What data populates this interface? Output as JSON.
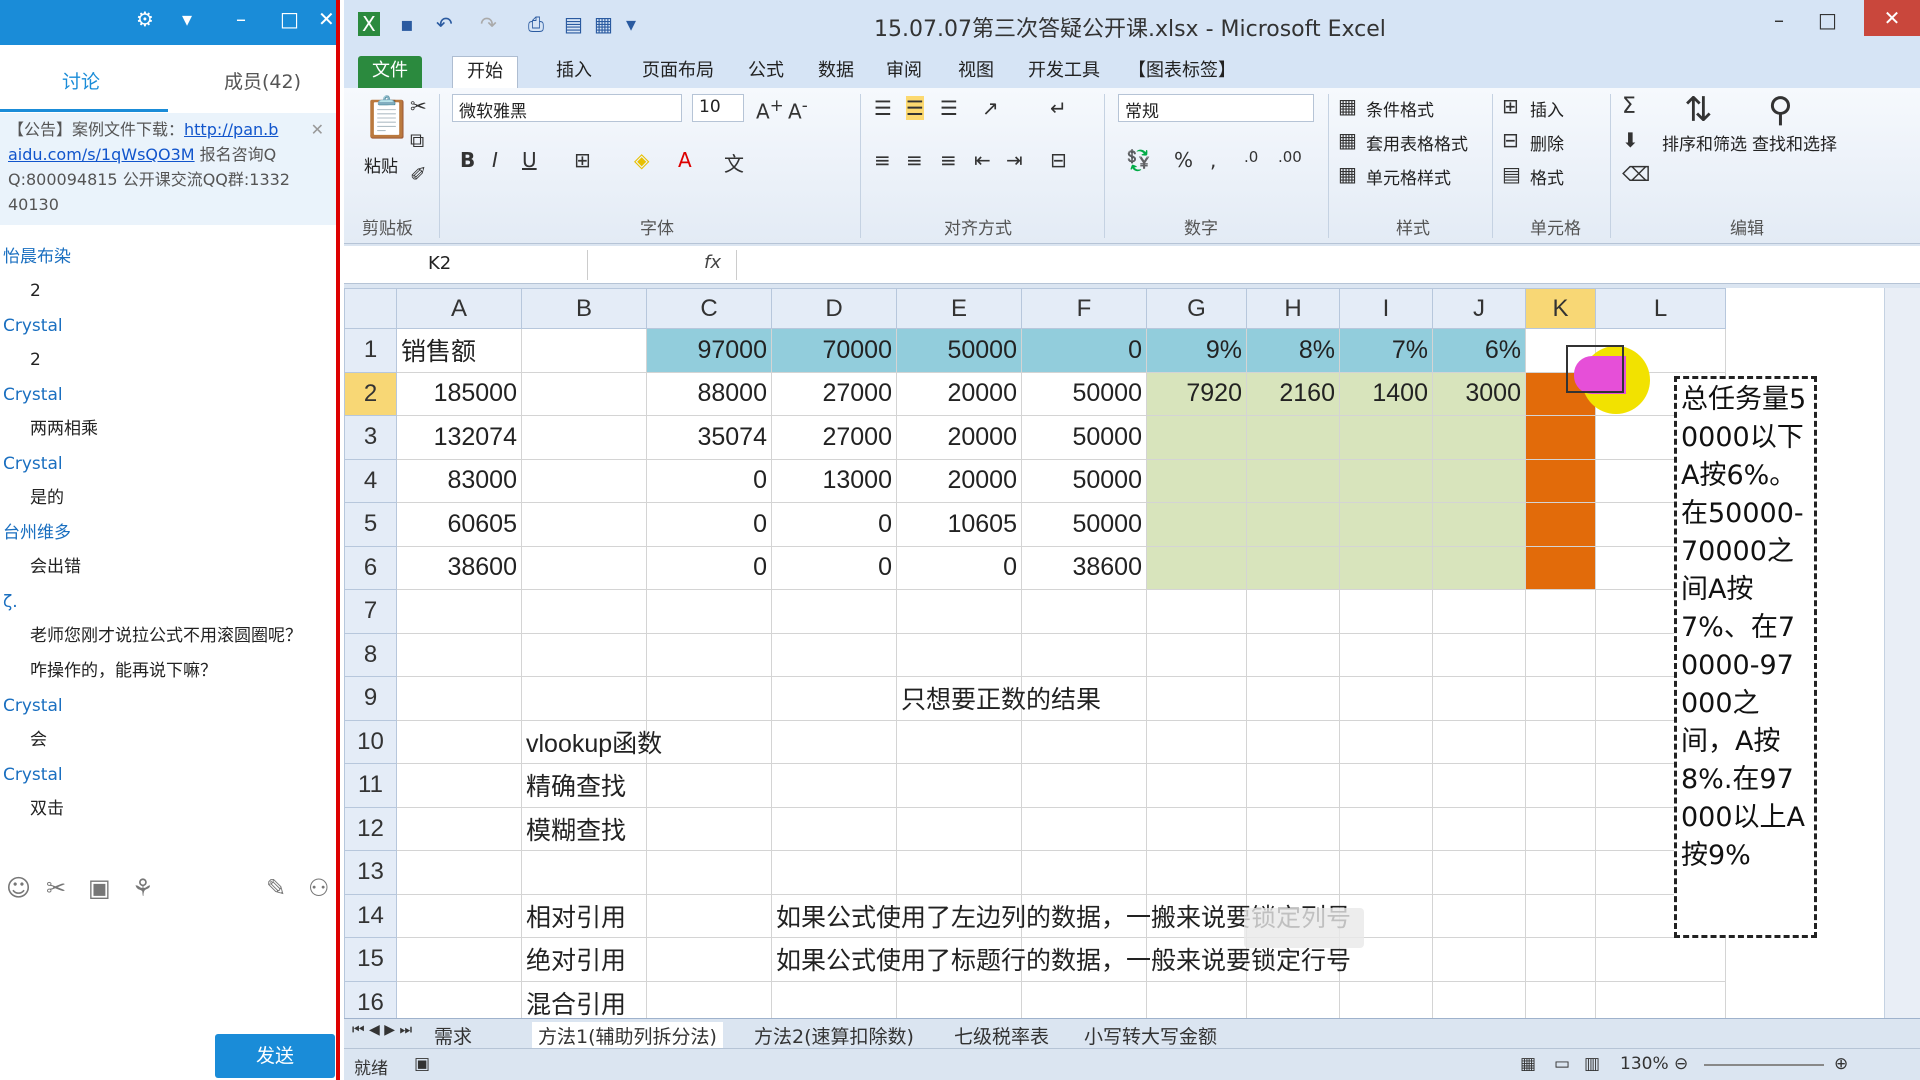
{
  "chat": {
    "tabs": [
      "讨论",
      "成员(42)"
    ],
    "notice": {
      "prefix": "【公告】案例文件下载：",
      "link1": "http://pan.b",
      "link2": "aidu.com/s/1qWsQO3M",
      "rest": " 报名咨询Q Q:800094815  公开课交流QQ群:1332 40130"
    },
    "messages": [
      {
        "name": "怡晨布染",
        "text": "2"
      },
      {
        "name": "Crystal",
        "text": "2"
      },
      {
        "name": "Crystal",
        "text": "两两相乘"
      },
      {
        "name": "Crystal",
        "text": "是的"
      },
      {
        "name": "台州维多",
        "text": "会出错"
      },
      {
        "name": "ζ.",
        "text": "老师您刚才说拉公式不用滚圆圈呢？"
      },
      {
        "name": "",
        "text": "咋操作的，能再说下嘛？"
      },
      {
        "name": "Crystal",
        "text": "会"
      },
      {
        "name": "Crystal",
        "text": "双击"
      }
    ],
    "send_label": "发送"
  },
  "excel": {
    "title": "15.07.07第三次答疑公开课.xlsx - Microsoft Excel",
    "ribbon_tabs": [
      "文件",
      "开始",
      "插入",
      "页面布局",
      "公式",
      "数据",
      "审阅",
      "视图",
      "开发工具",
      "【图表标签】"
    ],
    "font_name": "微软雅黑",
    "font_size": "10",
    "number_format": "常规",
    "buttons": {
      "paste": "粘贴",
      "cond_format": "条件格式",
      "table_format": "套用表格格式",
      "cell_style": "单元格样式",
      "insert": "插入",
      "delete": "删除",
      "format": "格式",
      "sort_filter": "排序和筛选",
      "find_select": "查找和选择"
    },
    "groups": [
      "剪贴板",
      "字体",
      "对齐方式",
      "数字",
      "样式",
      "单元格",
      "编辑"
    ],
    "name_box": "K2",
    "fx": "fx",
    "columns": [
      "A",
      "B",
      "C",
      "D",
      "E",
      "F",
      "G",
      "H",
      "I",
      "J",
      "K",
      "L"
    ],
    "rows": [
      [
        "销售额",
        "",
        "97000",
        "70000",
        "50000",
        "0",
        "9%",
        "8%",
        "7%",
        "6%",
        "",
        ""
      ],
      [
        "185000",
        "",
        "88000",
        "27000",
        "20000",
        "50000",
        "7920",
        "2160",
        "1400",
        "3000",
        "",
        ""
      ],
      [
        "132074",
        "",
        "35074",
        "27000",
        "20000",
        "50000",
        "",
        "",
        "",
        "",
        "",
        ""
      ],
      [
        "83000",
        "",
        "0",
        "13000",
        "20000",
        "50000",
        "",
        "",
        "",
        "",
        "",
        ""
      ],
      [
        "60605",
        "",
        "0",
        "0",
        "10605",
        "50000",
        "",
        "",
        "",
        "",
        "",
        ""
      ],
      [
        "38600",
        "",
        "0",
        "0",
        "0",
        "38600",
        "",
        "",
        "",
        "",
        "",
        ""
      ],
      [
        "",
        "",
        "",
        "",
        "",
        "",
        "",
        "",
        "",
        "",
        "",
        ""
      ],
      [
        "",
        "",
        "",
        "",
        "",
        "",
        "",
        "",
        "",
        "",
        "",
        ""
      ],
      [
        "",
        "",
        "",
        "",
        "只想要正数的结果",
        "",
        "",
        "",
        "",
        "",
        "",
        ""
      ],
      [
        "",
        "vlookup函数",
        "",
        "",
        "",
        "",
        "",
        "",
        "",
        "",
        "",
        ""
      ],
      [
        "",
        "精确查找",
        "",
        "",
        "",
        "",
        "",
        "",
        "",
        "",
        "",
        ""
      ],
      [
        "",
        "模糊查找",
        "",
        "",
        "",
        "",
        "",
        "",
        "",
        "",
        "",
        ""
      ],
      [
        "",
        "",
        "",
        "",
        "",
        "",
        "",
        "",
        "",
        "",
        "",
        ""
      ],
      [
        "",
        "相对引用",
        "",
        "如果公式使用了左边列的数据，一搬来说要锁定列号",
        "",
        "",
        "",
        "",
        "",
        "",
        "",
        ""
      ],
      [
        "",
        "绝对引用",
        "",
        "如果公式使用了标题行的数据，一般来说要锁定行号",
        "",
        "",
        "",
        "",
        "",
        "",
        "",
        ""
      ],
      [
        "",
        "混合引用",
        "",
        "",
        "",
        "",
        "",
        "",
        "",
        "",
        "",
        ""
      ]
    ],
    "note": "总任务量50000以下A按6%。在50000-70000之间A按7%、在70000-97000之间，A按8%.在97000以上A按9%",
    "sheet_tabs": [
      "需求",
      "方法1(辅助列拆分法)",
      "方法2(速算扣除数)",
      "七级税率表",
      "小写转大写金额"
    ],
    "status": "就绪",
    "zoom": "130%"
  }
}
